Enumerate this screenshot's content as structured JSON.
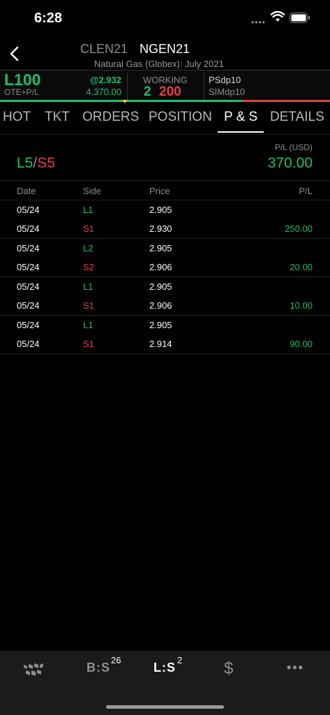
{
  "status": {
    "time": "6:28",
    "signal": "••••"
  },
  "header": {
    "contract_inactive": "CLEN21",
    "contract_active": "NGEN21",
    "subtitle": "Natural Gas (Globex): July 2021"
  },
  "account": {
    "position": "L100",
    "position_label": "OTE+P/L",
    "last_price": "@2.932",
    "pl": "4,370.00",
    "working_label": "WORKING",
    "working_buy": "2",
    "working_sell": "200",
    "route": "PSdp10",
    "sim": "SIMdp10"
  },
  "tabs": [
    "HOT",
    "TKT",
    "ORDERS",
    "POSITION",
    "P & S",
    "DETAILS"
  ],
  "active_tab": "P & S",
  "summary": {
    "long": "L5",
    "slash": "/",
    "short": "S5",
    "pl_header": "P/L (USD)",
    "pl_value": "370.00"
  },
  "table": {
    "headers": {
      "date": "Date",
      "side": "Side",
      "price": "Price",
      "pl": "P/L"
    },
    "groups": [
      [
        {
          "date": "05/24",
          "side": "L1",
          "price": "2.905",
          "pl": ""
        },
        {
          "date": "05/24",
          "side": "S1",
          "price": "2.930",
          "pl": "250.00"
        }
      ],
      [
        {
          "date": "05/24",
          "side": "L2",
          "price": "2.905",
          "pl": ""
        },
        {
          "date": "05/24",
          "side": "S2",
          "price": "2.906",
          "pl": "20.00"
        }
      ],
      [
        {
          "date": "05/24",
          "side": "L1",
          "price": "2.905",
          "pl": ""
        },
        {
          "date": "05/24",
          "side": "S1",
          "price": "2.906",
          "pl": "10.00"
        }
      ],
      [
        {
          "date": "05/24",
          "side": "L1",
          "price": "2.905",
          "pl": ""
        },
        {
          "date": "05/24",
          "side": "S1",
          "price": "2.914",
          "pl": "90.00"
        }
      ]
    ]
  },
  "bottom_nav": {
    "items": [
      {
        "name": "market-icon",
        "label": ""
      },
      {
        "name": "bs",
        "label": "B:S",
        "badge": "26"
      },
      {
        "name": "ls",
        "label": "L:S",
        "badge": "2"
      },
      {
        "name": "dollar-icon",
        "label": "$"
      },
      {
        "name": "more-icon",
        "label": "•••"
      }
    ]
  },
  "colors": {
    "long": "#1fbf6a",
    "short": "#e04048",
    "background": "#000000"
  }
}
